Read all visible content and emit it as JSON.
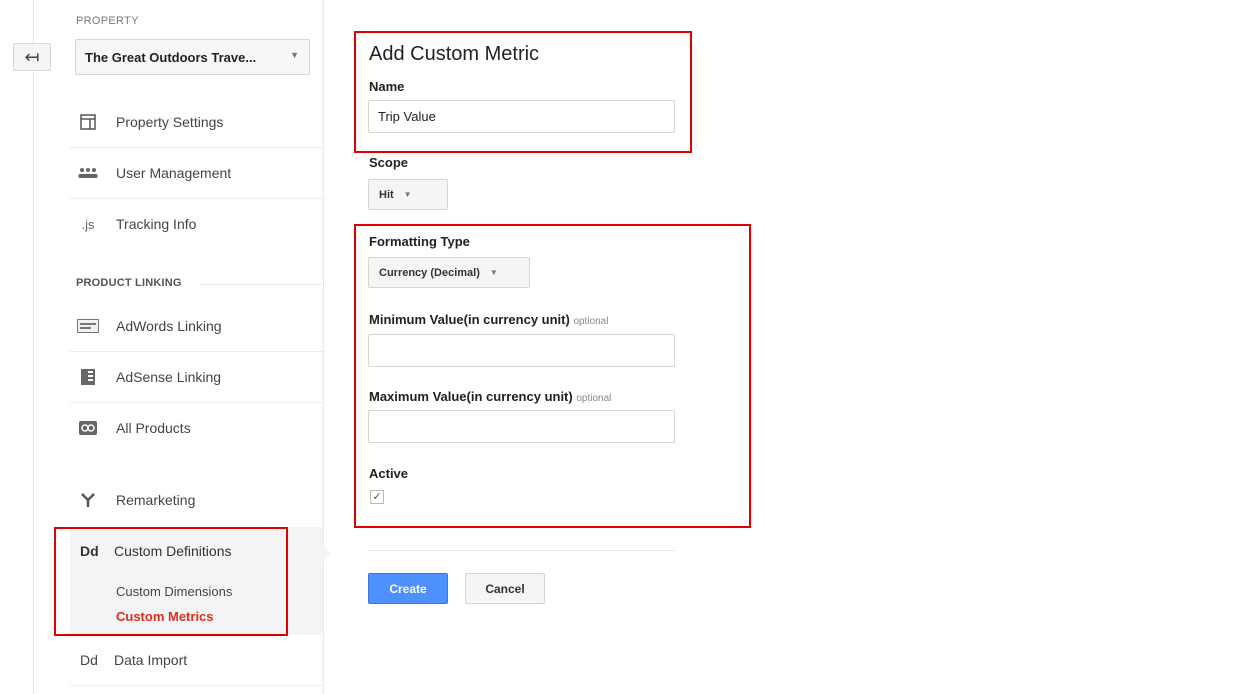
{
  "sidebar": {
    "back_icon": "↤",
    "property_label": "PROPERTY",
    "property_name": "The Great Outdoors Trave...",
    "items": [
      {
        "label": "Property Settings",
        "icon": "window-icon"
      },
      {
        "label": "User Management",
        "icon": "users-icon"
      },
      {
        "label": "Tracking Info",
        "icon": "js-icon",
        "glyph": ".js"
      }
    ],
    "product_linking_label": "PRODUCT LINKING",
    "linking_items": [
      {
        "label": "AdWords Linking",
        "icon": "adwords-icon"
      },
      {
        "label": "AdSense Linking",
        "icon": "adsense-icon"
      },
      {
        "label": "All Products",
        "icon": "link-icon"
      }
    ],
    "remarketing": {
      "label": "Remarketing",
      "icon": "remarketing-icon"
    },
    "custom_definitions": {
      "label": "Custom Definitions",
      "glyph": "Dd",
      "children": [
        {
          "label": "Custom Dimensions",
          "active": false
        },
        {
          "label": "Custom Metrics",
          "active": true
        }
      ]
    },
    "data_import": {
      "label": "Data Import",
      "glyph": "Dd"
    }
  },
  "form": {
    "title": "Add Custom Metric",
    "name_label": "Name",
    "name_value": "Trip Value",
    "scope_label": "Scope",
    "scope_value": "Hit",
    "formatting_label": "Formatting Type",
    "formatting_value": "Currency (Decimal)",
    "min_label": "Minimum Value(in currency unit)",
    "min_optional": "optional",
    "min_value": "",
    "max_label": "Maximum Value(in currency unit)",
    "max_optional": "optional",
    "max_value": "",
    "active_label": "Active",
    "active_checked": true,
    "active_mark": "✓",
    "create_label": "Create",
    "cancel_label": "Cancel"
  },
  "colors": {
    "highlight": "#e00000",
    "primary_button": "#4d90fe",
    "active_link": "#d93025"
  }
}
